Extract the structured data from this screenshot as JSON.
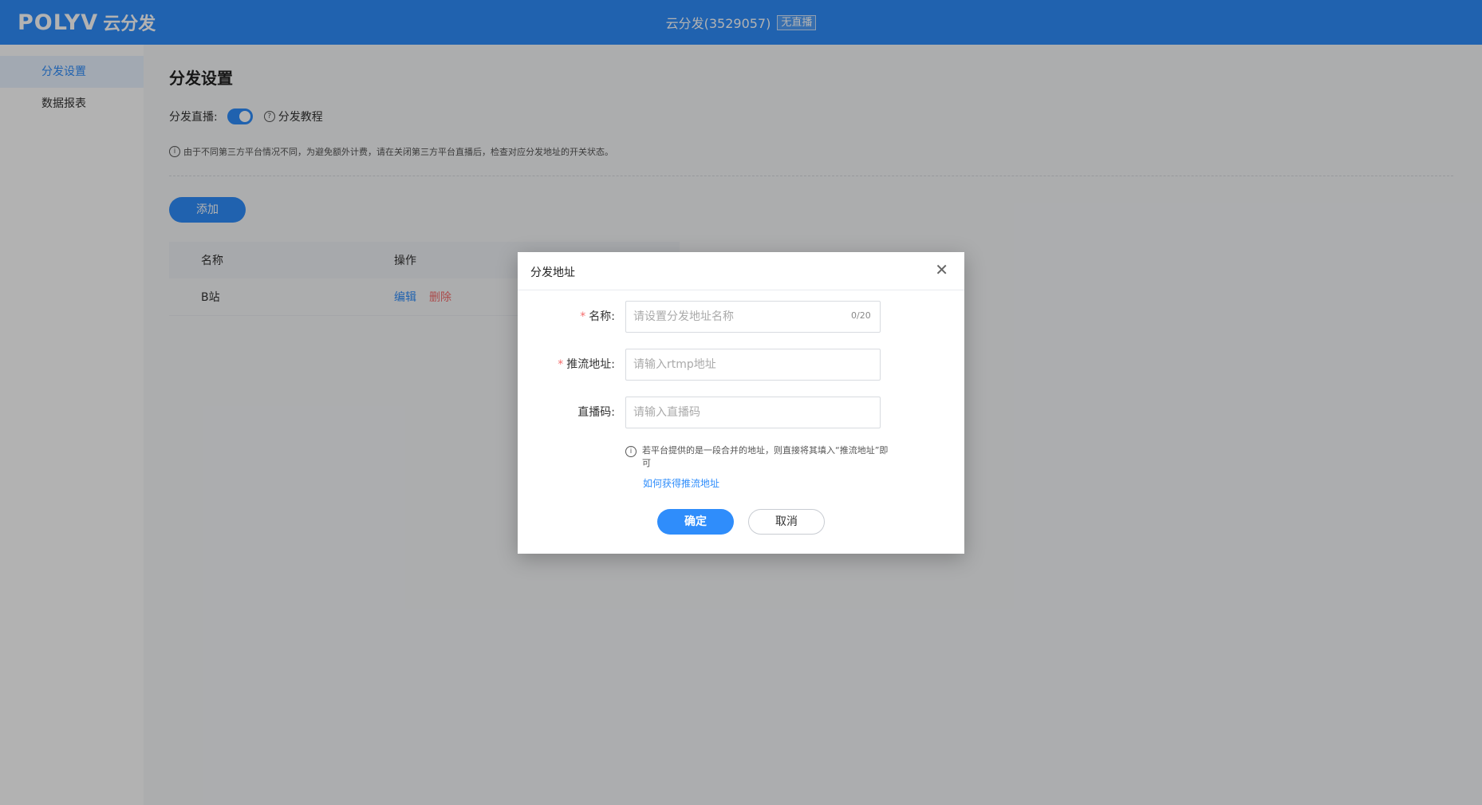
{
  "header": {
    "logo_brand": "POLYV",
    "logo_cn": "云分发",
    "title": "云分发(3529057)",
    "badge": "无直播"
  },
  "sidebar": {
    "items": [
      {
        "label": "分发设置",
        "active": true
      },
      {
        "label": "数据报表",
        "active": false
      }
    ]
  },
  "main": {
    "page_title": "分发设置",
    "live_label": "分发直播:",
    "live_enabled": true,
    "tutorial_label": "分发教程",
    "notice": "由于不同第三方平台情况不同，为避免额外计费，请在关闭第三方平台直播后，检查对应分发地址的开关状态。",
    "add_button": "添加",
    "table": {
      "headers": [
        "名称",
        "操作"
      ],
      "rows": [
        {
          "name": "B站",
          "edit": "编辑",
          "delete": "删除"
        }
      ]
    }
  },
  "modal": {
    "title": "分发地址",
    "close_icon": "close-icon",
    "fields": {
      "name": {
        "label": "名称:",
        "placeholder": "请设置分发地址名称",
        "value": "",
        "counter": "0/20",
        "required": true
      },
      "push_url": {
        "label": "推流地址:",
        "placeholder": "请输入rtmp地址",
        "value": "",
        "required": true
      },
      "stream_code": {
        "label": "直播码:",
        "placeholder": "请输入直播码",
        "value": "",
        "required": false
      }
    },
    "tip": "若平台提供的是一段合并的地址，则直接将其填入“推流地址”即可",
    "tip_link": "如何获得推流地址",
    "ok_button": "确定",
    "cancel_button": "取消"
  },
  "colors": {
    "primary": "#2f8dfb",
    "danger": "#f56c6c",
    "overlay": "rgba(0,0,0,0.30)"
  }
}
